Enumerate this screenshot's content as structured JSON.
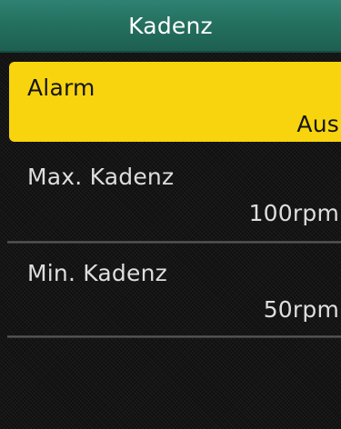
{
  "header": {
    "title": "Kadenz"
  },
  "items": [
    {
      "label": "Alarm",
      "value": "Aus",
      "selected": true
    },
    {
      "label": "Max. Kadenz",
      "value": "100rpm",
      "selected": false
    },
    {
      "label": "Min. Kadenz",
      "value": "50rpm",
      "selected": false
    }
  ],
  "colors": {
    "header_bg": "#24705f",
    "selection_bg": "#f7d40e",
    "screen_bg": "#141414"
  }
}
